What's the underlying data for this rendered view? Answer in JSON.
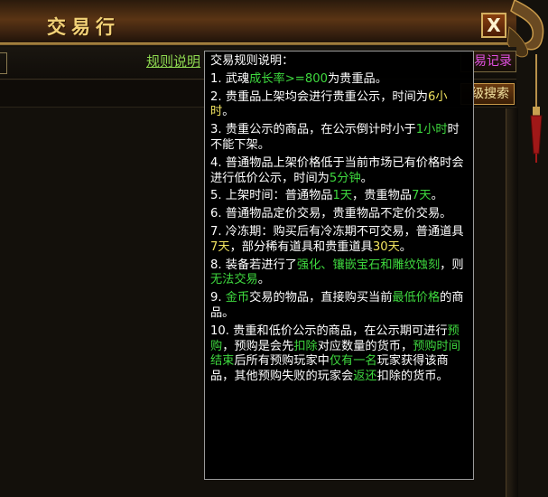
{
  "window": {
    "title": "交易行",
    "close_label": "X"
  },
  "toolbar": {
    "rules_link": "规则说明",
    "records_label": "易记录",
    "search_label": "级搜索"
  },
  "tooltip": {
    "heading": "交易规则说明：",
    "rules": [
      [
        {
          "t": "1. 武魂"
        },
        {
          "t": "成长率>=800",
          "c": "g"
        },
        {
          "t": "为贵重品。"
        }
      ],
      [
        {
          "t": "2. 贵重品上架均会进行贵重公示，时间为"
        },
        {
          "t": "6小时",
          "c": "y"
        },
        {
          "t": "。"
        }
      ],
      [
        {
          "t": "3. 贵重公示的商品，在公示倒计时小于"
        },
        {
          "t": "1小时",
          "c": "g"
        },
        {
          "t": "时不能下架。"
        }
      ],
      [
        {
          "t": "4. 普通物品上架价格低于当前市场已有价格时会进行低价公示，时间为"
        },
        {
          "t": "5分钟",
          "c": "g"
        },
        {
          "t": "。"
        }
      ],
      [
        {
          "t": "5. 上架时间：普通物品"
        },
        {
          "t": "1天",
          "c": "g"
        },
        {
          "t": "，贵重物品"
        },
        {
          "t": "7天",
          "c": "g"
        },
        {
          "t": "。"
        }
      ],
      [
        {
          "t": "6. 普通物品定价交易，贵重物品不定价交易。"
        }
      ],
      [
        {
          "t": "7. 冷冻期：购买后有冷冻期不可交易，普通道具"
        },
        {
          "t": "7天",
          "c": "y"
        },
        {
          "t": "，部分稀有道具和贵重道具"
        },
        {
          "t": "30天",
          "c": "y"
        },
        {
          "t": "。"
        }
      ],
      [
        {
          "t": "8. 装备若进行了"
        },
        {
          "t": "强化、镶嵌宝石和雕纹蚀刻",
          "c": "g"
        },
        {
          "t": "，则"
        },
        {
          "t": "无法交易",
          "c": "g"
        },
        {
          "t": "。"
        }
      ],
      [
        {
          "t": "9. "
        },
        {
          "t": "金币",
          "c": "g"
        },
        {
          "t": "交易的物品，直接购买当前"
        },
        {
          "t": "最低价格",
          "c": "g"
        },
        {
          "t": "的商品。"
        }
      ],
      [
        {
          "t": "10. 贵重和低价公示的商品，在公示期可进行"
        },
        {
          "t": "预购",
          "c": "g"
        },
        {
          "t": "，预购是会先"
        },
        {
          "t": "扣除",
          "c": "g"
        },
        {
          "t": "对应数量的货币，"
        },
        {
          "t": "预购时间结束",
          "c": "g"
        },
        {
          "t": "后所有预购玩家中"
        },
        {
          "t": "仅有一名",
          "c": "g"
        },
        {
          "t": "玩家获得该商品，其他预购失败的玩家会"
        },
        {
          "t": "返还",
          "c": "g"
        },
        {
          "t": "扣除的货币。"
        }
      ]
    ]
  },
  "colors": {
    "highlight_green": "#3ed83e",
    "highlight_yellow": "#f2e460",
    "title_gold": "#f2d278",
    "link_green": "#8ed850",
    "records_magenta": "#e050e0"
  },
  "icons": {
    "close": "close-icon",
    "ornament": "dragon-ornament-icon"
  }
}
